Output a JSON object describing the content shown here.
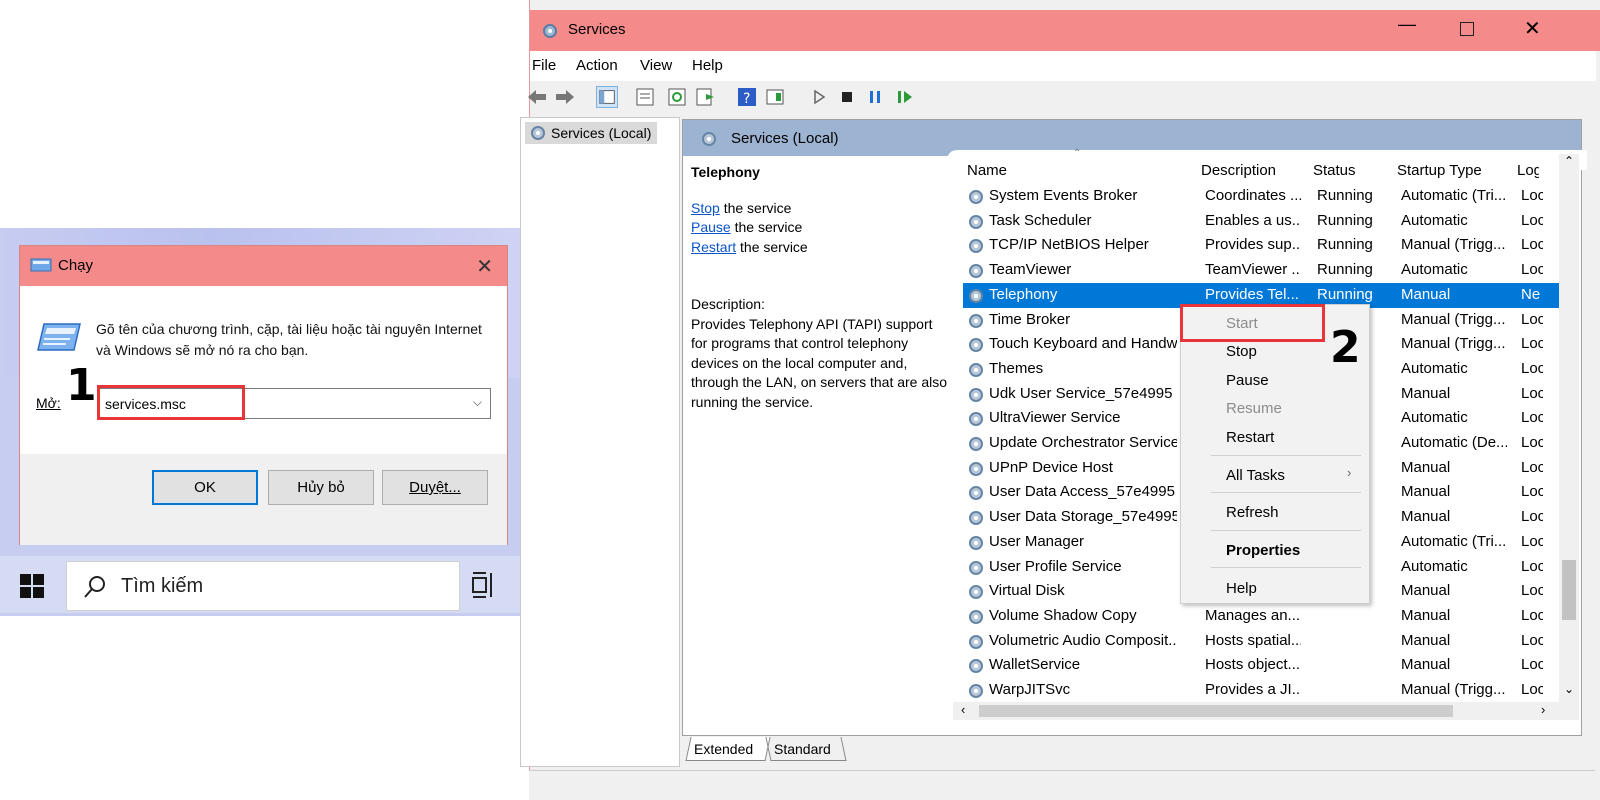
{
  "run_dialog": {
    "title": "Chạy",
    "description": "Gõ tên của chương trình, cặp, tài liệu hoặc tài nguyên Internet và Windows sẽ mở nó ra cho bạn.",
    "open_label": "Mở:",
    "input_value": "services.msc",
    "ok_label": "OK",
    "cancel_label": "Hủy bỏ",
    "browse_label": "Duyệt..."
  },
  "annotations": {
    "step1": "1",
    "step2": "2"
  },
  "taskbar": {
    "search_placeholder": "Tìm kiếm"
  },
  "services_window": {
    "title": "Services",
    "menu": [
      "File",
      "Action",
      "View",
      "Help"
    ],
    "tree_item": "Services (Local)",
    "content_header": "Services (Local)",
    "selected_service": {
      "name": "Telephony",
      "stop_link": "Stop",
      "stop_text": " the service",
      "pause_link": "Pause",
      "pause_text": " the service",
      "restart_link": "Restart",
      "restart_text": " the service",
      "description_label": "Description:",
      "description": "Provides Telephony API (TAPI) support for programs that control telephony devices on the local computer and, through the LAN, on servers that are also running the service."
    },
    "columns": [
      "Name",
      "Description",
      "Status",
      "Startup Type",
      "Log"
    ],
    "rows": [
      {
        "name": "System Events Broker",
        "description": "Coordinates ...",
        "status": "Running",
        "startup": "Automatic (Tri...",
        "log": "Loc"
      },
      {
        "name": "Task Scheduler",
        "description": "Enables a us...",
        "status": "Running",
        "startup": "Automatic",
        "log": "Loc"
      },
      {
        "name": "TCP/IP NetBIOS Helper",
        "description": "Provides sup...",
        "status": "Running",
        "startup": "Manual (Trigg...",
        "log": "Loc"
      },
      {
        "name": "TeamViewer",
        "description": "TeamViewer ...",
        "status": "Running",
        "startup": "Automatic",
        "log": "Loc"
      },
      {
        "name": "Telephony",
        "description": "Provides Tel...",
        "status": "Running",
        "startup": "Manual",
        "log": "Ne"
      },
      {
        "name": "Time Broker",
        "description": "",
        "status": "",
        "startup": "Manual (Trigg...",
        "log": "Loc"
      },
      {
        "name": "Touch Keyboard and Handw...",
        "description": "",
        "status": "",
        "startup": "Manual (Trigg...",
        "log": "Loc"
      },
      {
        "name": "Themes",
        "description": "",
        "status": "",
        "startup": "Automatic",
        "log": "Loc"
      },
      {
        "name": "Udk User Service_57e4995",
        "description": "",
        "status": "",
        "startup": "Manual",
        "log": "Loc"
      },
      {
        "name": "UltraViewer Service",
        "description": "",
        "status": "",
        "startup": "Automatic",
        "log": "Loc"
      },
      {
        "name": "Update Orchestrator Service",
        "description": "",
        "status": "",
        "startup": "Automatic (De...",
        "log": "Loc"
      },
      {
        "name": "UPnP Device Host",
        "description": "",
        "status": "",
        "startup": "Manual",
        "log": "Loc"
      },
      {
        "name": "User Data Access_57e4995",
        "description": "",
        "status": "",
        "startup": "Manual",
        "log": "Loc"
      },
      {
        "name": "User Data Storage_57e4995",
        "description": "",
        "status": "",
        "startup": "Manual",
        "log": "Loc"
      },
      {
        "name": "User Manager",
        "description": "",
        "status": "",
        "startup": "Automatic (Tri...",
        "log": "Loc"
      },
      {
        "name": "User Profile Service",
        "description": "",
        "status": "",
        "startup": "Automatic",
        "log": "Loc"
      },
      {
        "name": "Virtual Disk",
        "description": "",
        "status": "",
        "startup": "Manual",
        "log": "Loc"
      },
      {
        "name": "Volume Shadow Copy",
        "description": "Manages an...",
        "status": "",
        "startup": "Manual",
        "log": "Loc"
      },
      {
        "name": "Volumetric Audio Composit...",
        "description": "Hosts spatial...",
        "status": "",
        "startup": "Manual",
        "log": "Loc"
      },
      {
        "name": "WalletService",
        "description": "Hosts object...",
        "status": "",
        "startup": "Manual",
        "log": "Loc"
      },
      {
        "name": "WarpJITSvc",
        "description": "Provides a JI...",
        "status": "",
        "startup": "Manual (Trigg...",
        "log": "Loc"
      }
    ],
    "tabs": [
      "Extended",
      "Standard"
    ]
  },
  "context_menu": {
    "start": "Start",
    "stop": "Stop",
    "pause": "Pause",
    "resume": "Resume",
    "restart": "Restart",
    "all_tasks": "All Tasks",
    "refresh": "Refresh",
    "properties": "Properties",
    "help": "Help"
  },
  "colors": {
    "title_bar": "#f58a8a",
    "selection": "#0078d7",
    "highlight_box": "#e8353a"
  }
}
